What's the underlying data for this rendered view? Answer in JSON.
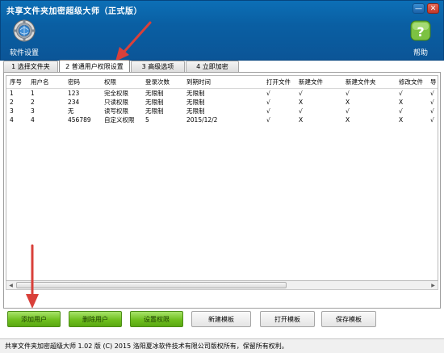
{
  "window": {
    "title": "共享文件夹加密超级大师（正式版）",
    "minimize_glyph": "—",
    "close_glyph": "✕"
  },
  "toolbar": {
    "settings_label": "软件设置",
    "settings_icon": "gear-globe-icon",
    "help_label": "帮助",
    "help_icon": "help-question-icon"
  },
  "tabs": [
    {
      "label": "1 选择文件夹",
      "active": false
    },
    {
      "label": "2 普通用户权限设置",
      "active": true
    },
    {
      "label": "3 高级选项",
      "active": false
    },
    {
      "label": "4 立即加密",
      "active": false
    }
  ],
  "table": {
    "columns": [
      "序号",
      "用户名",
      "密码",
      "权限",
      "登录次数",
      "到期时间",
      "打开文件",
      "新建文件",
      "新建文件夹",
      "修改文件",
      "导"
    ],
    "rows": [
      [
        "1",
        "1",
        "123",
        "完全权限",
        "无限制",
        "无限制",
        "√",
        "√",
        "√",
        "√",
        "√"
      ],
      [
        "2",
        "2",
        "234",
        "只读权限",
        "无限制",
        "无限制",
        "√",
        "X",
        "X",
        "X",
        "√"
      ],
      [
        "3",
        "3",
        "无",
        "读写权限",
        "无限制",
        "无限制",
        "√",
        "√",
        "√",
        "√",
        "√"
      ],
      [
        "4",
        "4",
        "456789",
        "自定义权限",
        "5",
        "2015/12/2",
        "√",
        "X",
        "X",
        "X",
        "√"
      ]
    ]
  },
  "buttons": {
    "add_user": "添加用户",
    "delete_user": "删除用户",
    "set_permission": "设置权限",
    "new_template": "新建模板",
    "open_template": "打开模板",
    "save_template": "保存模板"
  },
  "footer": {
    "text": "共享文件夹加密超级大师 1.02 版  (C)  2015 洛阳夏冰软件技术有限公司版权所有，保留所有权利。"
  },
  "colors": {
    "header_blue": "#0b5fa3",
    "accent_green": "#6fbf1f",
    "annotation_red": "#d9403a"
  }
}
